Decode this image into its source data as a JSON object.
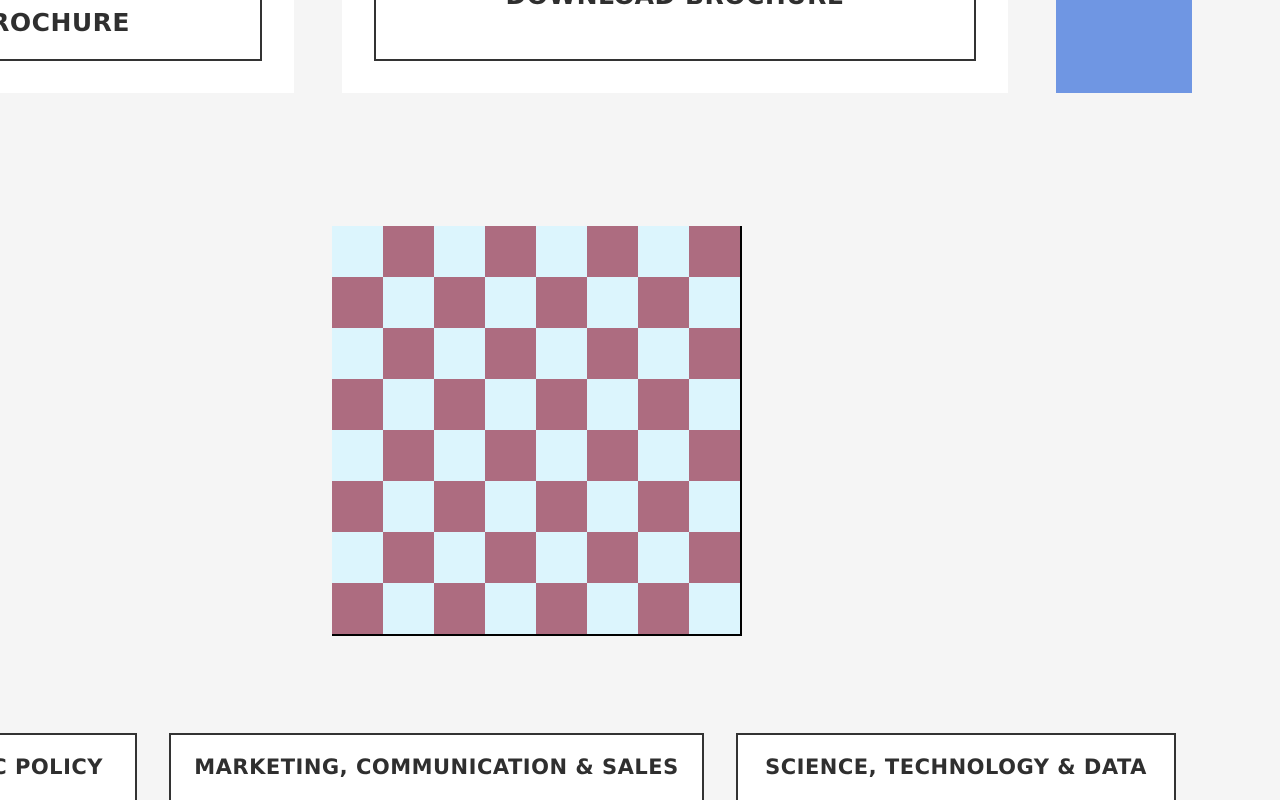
{
  "brochure": {
    "left_label": "ROCHURE",
    "mid_label": "DOWNLOAD BROCHURE"
  },
  "colors": {
    "background": "#f5f5f5",
    "card": "#ffffff",
    "accent_blue": "#6f96e3",
    "square_light": "#dcf5fd",
    "square_dark": "#ad6c80",
    "button_border": "#333333"
  },
  "board": {
    "rows": 8,
    "cols": 8,
    "top_left": "light"
  },
  "categories": [
    {
      "label": "C POLICY"
    },
    {
      "label": "MARKETING, COMMUNICATION & SALES"
    },
    {
      "label": "SCIENCE, TECHNOLOGY & DATA"
    }
  ]
}
